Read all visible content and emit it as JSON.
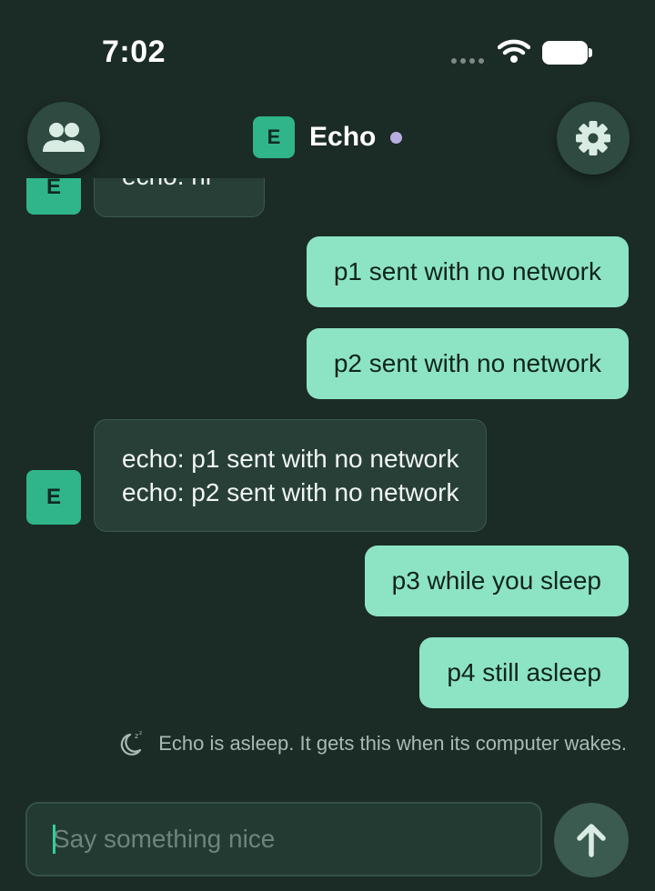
{
  "status_bar": {
    "time": "7:02"
  },
  "header": {
    "avatar_letter": "E",
    "title": "Echo",
    "presence_color": "#b8aee0",
    "left_button_icon": "people-icon",
    "right_button_icon": "gear-icon"
  },
  "messages": {
    "partial_incoming": {
      "avatar_letter": "E",
      "text": "echo: hi"
    },
    "out1": "p1 sent with no network",
    "out2": "p2 sent with no network",
    "in1": {
      "avatar_letter": "E",
      "line1": "echo: p1 sent with no network",
      "line2": "echo: p2 sent with no network"
    },
    "out3": "p3 while you sleep",
    "out4": "p4 still asleep"
  },
  "sleep_notice": {
    "icon": "moon-sleep-icon",
    "text": "Echo is asleep. It gets this when its computer wakes."
  },
  "composer": {
    "placeholder": "Say something nice",
    "value": ""
  },
  "send_button": {
    "icon": "arrow-up-icon"
  },
  "colors": {
    "accent": "#2fb589",
    "outgoing_bubble": "#8de4c5",
    "background": "#1b2b25"
  }
}
